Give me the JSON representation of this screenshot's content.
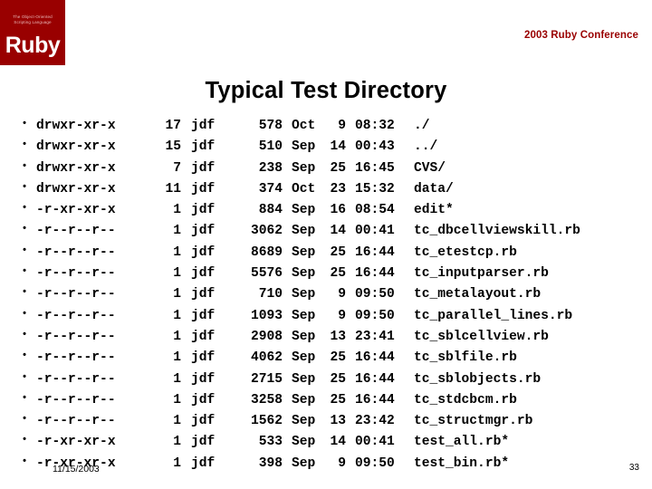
{
  "logo": {
    "tagline_line1": "The Object-Oriented",
    "tagline_line2": "Scripting Language",
    "wordmark": "Ruby",
    "background_color": "#990000"
  },
  "header": {
    "conference": "2003 Ruby Conference",
    "accent_color": "#990000"
  },
  "title": "Typical Test Directory",
  "listing": {
    "bullet_glyph": "•",
    "rows": [
      {
        "permissions": "drwxr-xr-x",
        "links": "17",
        "owner": "jdf",
        "size": "578",
        "month": "Oct",
        "day": "9",
        "time": "08:32",
        "name": "./"
      },
      {
        "permissions": "drwxr-xr-x",
        "links": "15",
        "owner": "jdf",
        "size": "510",
        "month": "Sep",
        "day": "14",
        "time": "00:43",
        "name": "../"
      },
      {
        "permissions": "drwxr-xr-x",
        "links": "7",
        "owner": "jdf",
        "size": "238",
        "month": "Sep",
        "day": "25",
        "time": "16:45",
        "name": "CVS/"
      },
      {
        "permissions": "drwxr-xr-x",
        "links": "11",
        "owner": "jdf",
        "size": "374",
        "month": "Oct",
        "day": "23",
        "time": "15:32",
        "name": "data/"
      },
      {
        "permissions": "-r-xr-xr-x",
        "links": "1",
        "owner": "jdf",
        "size": "884",
        "month": "Sep",
        "day": "16",
        "time": "08:54",
        "name": "edit*"
      },
      {
        "permissions": "-r--r--r--",
        "links": "1",
        "owner": "jdf",
        "size": "3062",
        "month": "Sep",
        "day": "14",
        "time": "00:41",
        "name": "tc_dbcellviewskill.rb"
      },
      {
        "permissions": "-r--r--r--",
        "links": "1",
        "owner": "jdf",
        "size": "8689",
        "month": "Sep",
        "day": "25",
        "time": "16:44",
        "name": "tc_etestcp.rb"
      },
      {
        "permissions": "-r--r--r--",
        "links": "1",
        "owner": "jdf",
        "size": "5576",
        "month": "Sep",
        "day": "25",
        "time": "16:44",
        "name": "tc_inputparser.rb"
      },
      {
        "permissions": "-r--r--r--",
        "links": "1",
        "owner": "jdf",
        "size": "710",
        "month": "Sep",
        "day": "9",
        "time": "09:50",
        "name": "tc_metalayout.rb"
      },
      {
        "permissions": "-r--r--r--",
        "links": "1",
        "owner": "jdf",
        "size": "1093",
        "month": "Sep",
        "day": "9",
        "time": "09:50",
        "name": "tc_parallel_lines.rb"
      },
      {
        "permissions": "-r--r--r--",
        "links": "1",
        "owner": "jdf",
        "size": "2908",
        "month": "Sep",
        "day": "13",
        "time": "23:41",
        "name": "tc_sblcellview.rb"
      },
      {
        "permissions": "-r--r--r--",
        "links": "1",
        "owner": "jdf",
        "size": "4062",
        "month": "Sep",
        "day": "25",
        "time": "16:44",
        "name": "tc_sblfile.rb"
      },
      {
        "permissions": "-r--r--r--",
        "links": "1",
        "owner": "jdf",
        "size": "2715",
        "month": "Sep",
        "day": "25",
        "time": "16:44",
        "name": "tc_sblobjects.rb"
      },
      {
        "permissions": "-r--r--r--",
        "links": "1",
        "owner": "jdf",
        "size": "3258",
        "month": "Sep",
        "day": "25",
        "time": "16:44",
        "name": "tc_stdcbcm.rb"
      },
      {
        "permissions": "-r--r--r--",
        "links": "1",
        "owner": "jdf",
        "size": "1562",
        "month": "Sep",
        "day": "13",
        "time": "23:42",
        "name": "tc_structmgr.rb"
      },
      {
        "permissions": "-r-xr-xr-x",
        "links": "1",
        "owner": "jdf",
        "size": "533",
        "month": "Sep",
        "day": "14",
        "time": "00:41",
        "name": "test_all.rb*"
      },
      {
        "permissions": "-r-xr-xr-x",
        "links": "1",
        "owner": "jdf",
        "size": "398",
        "month": "Sep",
        "day": "9",
        "time": "09:50",
        "name": "test_bin.rb*"
      }
    ]
  },
  "footer": {
    "date": "11/15/2003",
    "page_number": "33"
  }
}
